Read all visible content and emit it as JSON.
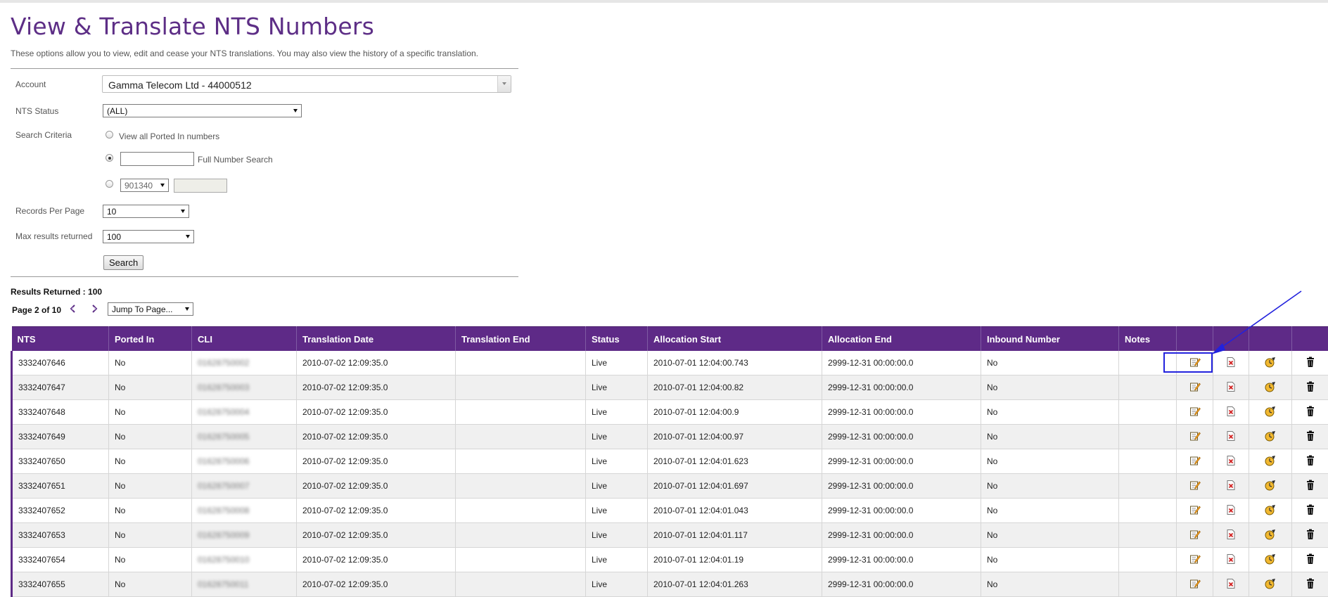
{
  "page": {
    "title": "View & Translate NTS Numbers",
    "description": "These options allow you to view, edit and cease your NTS translations. You may also view the history of a specific translation."
  },
  "form": {
    "account_label": "Account",
    "account_value": "Gamma Telecom Ltd - 44000512",
    "nts_status_label": "NTS Status",
    "nts_status_value": "(ALL)",
    "search_criteria_label": "Search Criteria",
    "option_ported": "View all Ported In numbers",
    "option_full": "Full Number Search",
    "full_number_value": "",
    "prefix_value": "901340",
    "records_label": "Records Per Page",
    "records_value": "10",
    "max_label": "Max results returned",
    "max_value": "100",
    "search_button": "Search"
  },
  "results": {
    "count_text": "Results Returned : 100",
    "page_text": "Page 2 of 10",
    "jump_label": "Jump To Page..."
  },
  "table": {
    "headers": [
      "NTS",
      "Ported In",
      "CLI",
      "Translation Date",
      "Translation End",
      "Status",
      "Allocation Start",
      "Allocation End",
      "Inbound Number",
      "Notes"
    ],
    "rows": [
      {
        "nts": "3332407646",
        "ported": "No",
        "cli": "01628750002",
        "tdate": "2010-07-02 12:09:35.0",
        "tend": "",
        "status": "Live",
        "astart": "2010-07-01 12:04:00.743",
        "aend": "2999-12-31 00:00:00.0",
        "inbound": "No",
        "notes": ""
      },
      {
        "nts": "3332407647",
        "ported": "No",
        "cli": "01628750003",
        "tdate": "2010-07-02 12:09:35.0",
        "tend": "",
        "status": "Live",
        "astart": "2010-07-01 12:04:00.82",
        "aend": "2999-12-31 00:00:00.0",
        "inbound": "No",
        "notes": ""
      },
      {
        "nts": "3332407648",
        "ported": "No",
        "cli": "01628750004",
        "tdate": "2010-07-02 12:09:35.0",
        "tend": "",
        "status": "Live",
        "astart": "2010-07-01 12:04:00.9",
        "aend": "2999-12-31 00:00:00.0",
        "inbound": "No",
        "notes": ""
      },
      {
        "nts": "3332407649",
        "ported": "No",
        "cli": "01628750005",
        "tdate": "2010-07-02 12:09:35.0",
        "tend": "",
        "status": "Live",
        "astart": "2010-07-01 12:04:00.97",
        "aend": "2999-12-31 00:00:00.0",
        "inbound": "No",
        "notes": ""
      },
      {
        "nts": "3332407650",
        "ported": "No",
        "cli": "01628750006",
        "tdate": "2010-07-02 12:09:35.0",
        "tend": "",
        "status": "Live",
        "astart": "2010-07-01 12:04:01.623",
        "aend": "2999-12-31 00:00:00.0",
        "inbound": "No",
        "notes": ""
      },
      {
        "nts": "3332407651",
        "ported": "No",
        "cli": "01628750007",
        "tdate": "2010-07-02 12:09:35.0",
        "tend": "",
        "status": "Live",
        "astart": "2010-07-01 12:04:01.697",
        "aend": "2999-12-31 00:00:00.0",
        "inbound": "No",
        "notes": ""
      },
      {
        "nts": "3332407652",
        "ported": "No",
        "cli": "01628750008",
        "tdate": "2010-07-02 12:09:35.0",
        "tend": "",
        "status": "Live",
        "astart": "2010-07-01 12:04:01.043",
        "aend": "2999-12-31 00:00:00.0",
        "inbound": "No",
        "notes": ""
      },
      {
        "nts": "3332407653",
        "ported": "No",
        "cli": "01628750009",
        "tdate": "2010-07-02 12:09:35.0",
        "tend": "",
        "status": "Live",
        "astart": "2010-07-01 12:04:01.117",
        "aend": "2999-12-31 00:00:00.0",
        "inbound": "No",
        "notes": ""
      },
      {
        "nts": "3332407654",
        "ported": "No",
        "cli": "01628750010",
        "tdate": "2010-07-02 12:09:35.0",
        "tend": "",
        "status": "Live",
        "astart": "2010-07-01 12:04:01.19",
        "aend": "2999-12-31 00:00:00.0",
        "inbound": "No",
        "notes": ""
      },
      {
        "nts": "3332407655",
        "ported": "No",
        "cli": "01628750011",
        "tdate": "2010-07-02 12:09:35.0",
        "tend": "",
        "status": "Live",
        "astart": "2010-07-01 12:04:01.263",
        "aend": "2999-12-31 00:00:00.0",
        "inbound": "No",
        "notes": ""
      }
    ],
    "row_icons": [
      "edit-icon",
      "cease-icon",
      "history-icon",
      "delete-icon"
    ]
  },
  "colors": {
    "brand_purple": "#5e2a87",
    "annotation_blue": "#2222dd"
  }
}
